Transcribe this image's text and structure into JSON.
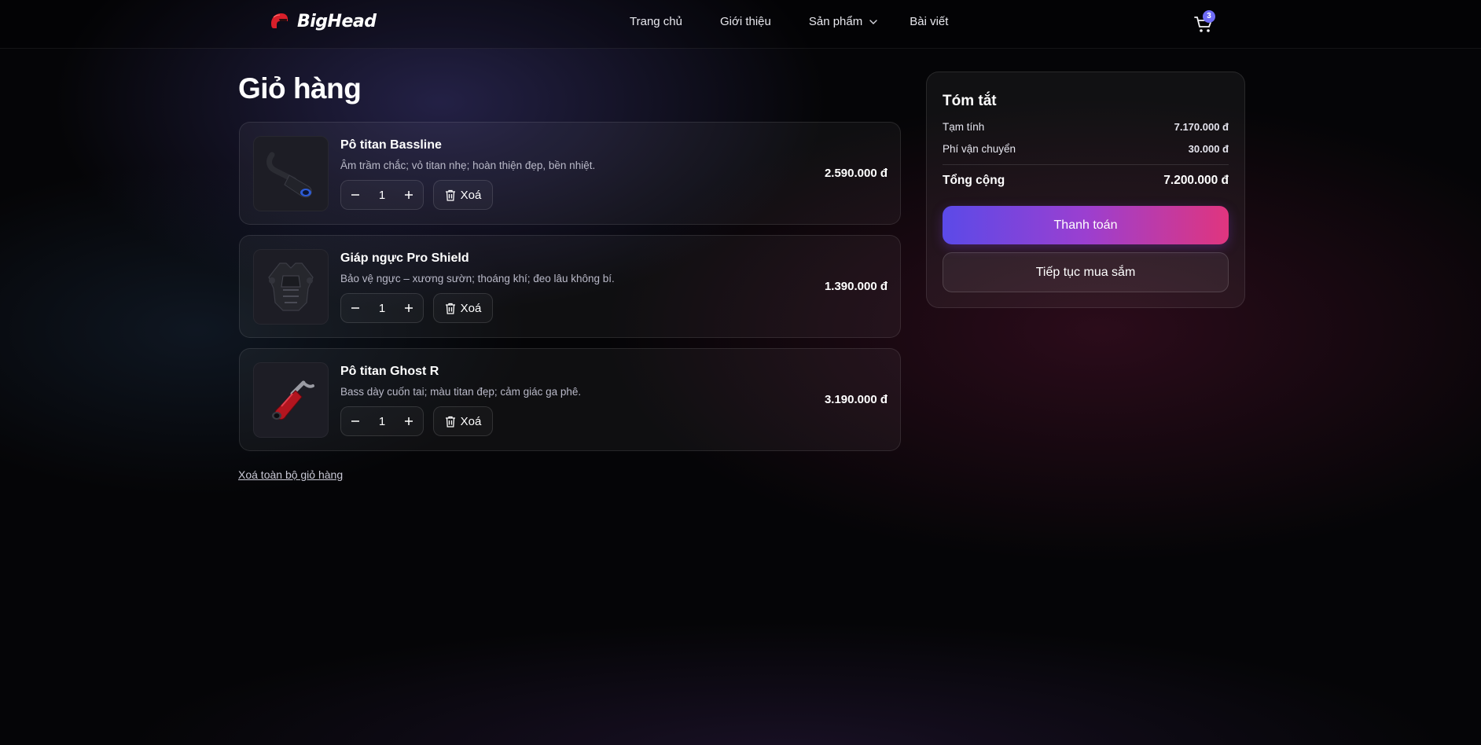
{
  "brand": {
    "name": "BigHead",
    "accent": "#e0232e"
  },
  "nav": {
    "items": [
      "Trang chủ",
      "Giới thiệu",
      "Sản phẩm",
      "Bài viết"
    ]
  },
  "cart": {
    "icon": "shopping-cart-icon",
    "count": "3"
  },
  "page": {
    "title": "Giỏ hàng"
  },
  "items": [
    {
      "name": "Pô titan Bassline",
      "desc": "Âm trầm chắc; vỏ titan nhẹ; hoàn thiện đẹp, bền nhiệt.",
      "qty": "1",
      "price": "2.590.000 đ",
      "delete_label": "Xoá",
      "image": "exhaust-black-icon"
    },
    {
      "name": "Giáp ngực Pro Shield",
      "desc": "Bảo vệ ngực – xương sườn; thoáng khí; đeo lâu không bí.",
      "qty": "1",
      "price": "1.390.000 đ",
      "delete_label": "Xoá",
      "image": "chest-armor-icon"
    },
    {
      "name": "Pô titan Ghost R",
      "desc": "Bass dày cuốn tai; màu titan đẹp; cảm giác ga phê.",
      "qty": "1",
      "price": "3.190.000 đ",
      "delete_label": "Xoá",
      "image": "exhaust-red-icon"
    }
  ],
  "clear_all": "Xoá toàn bộ giỏ hàng",
  "summary": {
    "title": "Tóm tắt",
    "subtotal_label": "Tạm tính",
    "subtotal": "7.170.000 đ",
    "shipping_label": "Phí vận chuyển",
    "shipping": "30.000 đ",
    "total_label": "Tổng cộng",
    "total": "7.200.000 đ",
    "pay_label": "Thanh toán",
    "continue_label": "Tiếp tục mua sắm",
    "pay_gradient": [
      "#5b4ae8",
      "#9b3fd0",
      "#e0357e"
    ]
  }
}
